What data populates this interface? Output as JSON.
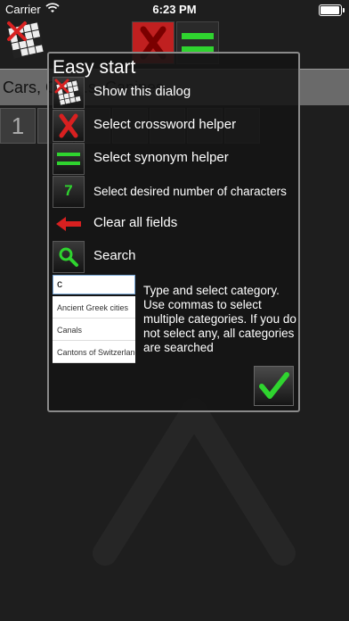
{
  "status_bar": {
    "carrier": "Carrier",
    "time": "6:23 PM"
  },
  "background": {
    "search_value": "Cars, C...   ...s, Canines",
    "cell_digit": "1"
  },
  "dialog": {
    "title": "Easy start",
    "items": [
      {
        "icon": "crossword-logo-icon",
        "label": "Show this dialog"
      },
      {
        "icon": "red-x-icon",
        "label": "Select crossword helper"
      },
      {
        "icon": "green-equals-icon",
        "label": "Select synonym helper"
      },
      {
        "icon": "number-seven-icon",
        "label": "Select desired number of characters",
        "icon_text": "7"
      },
      {
        "icon": "red-arrow-left-icon",
        "label": "Clear all fields"
      },
      {
        "icon": "magnifier-icon",
        "label": "Search"
      }
    ],
    "category_input": {
      "value": "c"
    },
    "category_options": [
      "Ancient Greek cities",
      "Canals",
      "Cantons of Switzerland"
    ],
    "help_text": "Type and select category. Use commas to select multiple categories. If you do not select any, all categories are searched",
    "ok_button": "checkmark-icon"
  },
  "colors": {
    "accent_green": "#2fd42f",
    "accent_red": "#d82020",
    "background": "#1e1e1e"
  }
}
